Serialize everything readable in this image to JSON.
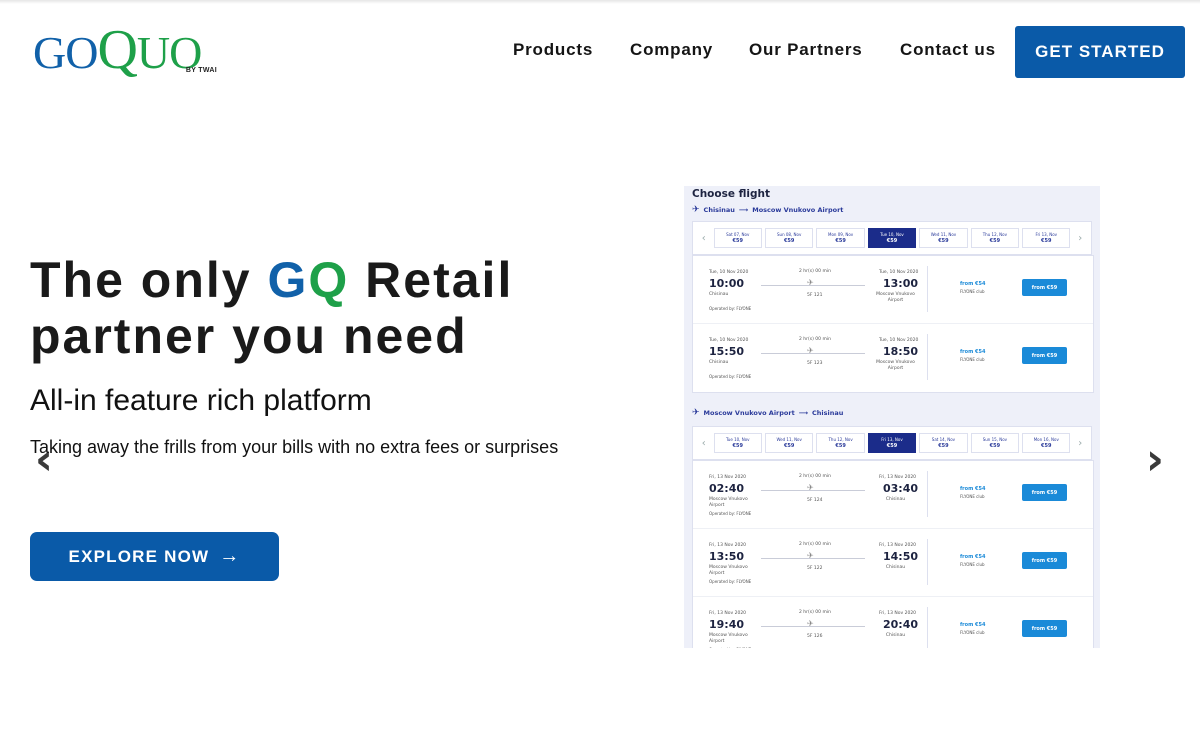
{
  "header": {
    "logo": {
      "go": "GO",
      "q": "Q",
      "uo": "UO",
      "tagline": "BY TWAI"
    },
    "nav": [
      {
        "label": "Products"
      },
      {
        "label": "Company"
      },
      {
        "label": "Our Partners"
      },
      {
        "label": "Contact us"
      }
    ],
    "cta_label": "GET STARTED"
  },
  "hero": {
    "headline_part1": "The only ",
    "headline_g": "G",
    "headline_q": "Q",
    "headline_part2": " Retail",
    "headline_line2": "partner you need",
    "subhead": "All-in feature rich platform",
    "description": "Taking away the frills from your bills with no extra fees or surprises",
    "explore_label": "EXPLORE NOW",
    "arrow_glyph": "→"
  },
  "carousel": {
    "prev_glyph": "‹",
    "next_glyph": "›"
  },
  "flight_panel": {
    "title": "Choose flight",
    "outbound": {
      "from": "Chisinau",
      "to": "Moscow Vnukovo Airport",
      "dates": [
        {
          "label": "Sat 07, Nov",
          "price": "€59"
        },
        {
          "label": "Sun 08, Nov",
          "price": "€59"
        },
        {
          "label": "Mon 09, Nov",
          "price": "€59"
        },
        {
          "label": "Tue 10, Nov",
          "price": "€59"
        },
        {
          "label": "Wed 11, Nov",
          "price": "€59"
        },
        {
          "label": "Thu 12, Nov",
          "price": "€59"
        },
        {
          "label": "Fri 13, Nov",
          "price": "€59"
        }
      ],
      "flights": [
        {
          "dep_date": "Tue, 10 Nov 2020",
          "dep": "10:00",
          "dep_place": "Chisinau",
          "duration": "2 hr(s) 00 min",
          "code": "5F 121",
          "arr_date": "Tue, 10 Nov 2020",
          "arr": "13:00",
          "arr_place": "Moscow Vnukovo Airport",
          "operator": "Operated by: FLYONE",
          "from_price": "from €54",
          "club": "FLYONE club",
          "button": "from €59"
        },
        {
          "dep_date": "Tue, 10 Nov 2020",
          "dep": "15:50",
          "dep_place": "Chisinau",
          "duration": "2 hr(s) 00 min",
          "code": "5F 123",
          "arr_date": "Tue, 10 Nov 2020",
          "arr": "18:50",
          "arr_place": "Moscow Vnukovo Airport",
          "operator": "Operated by: FLYONE",
          "from_price": "from €54",
          "club": "FLYONE club",
          "button": "from €59"
        }
      ]
    },
    "inbound": {
      "from": "Moscow Vnukovo Airport",
      "to": "Chisinau",
      "dates": [
        {
          "label": "Tue 10, Nov",
          "price": "€59"
        },
        {
          "label": "Wed 11, Nov",
          "price": "€59"
        },
        {
          "label": "Thu 12, Nov",
          "price": "€59"
        },
        {
          "label": "Fri 13, Nov",
          "price": "€59"
        },
        {
          "label": "Sat 14, Nov",
          "price": "€59"
        },
        {
          "label": "Sun 15, Nov",
          "price": "€59"
        },
        {
          "label": "Mon 16, Nov",
          "price": "€59"
        }
      ],
      "flights": [
        {
          "dep_date": "Fri, 13 Nov 2020",
          "dep": "02:40",
          "dep_place": "Moscow Vnukovo Airport",
          "duration": "2 hr(s) 00 min",
          "code": "5F 124",
          "arr_date": "Fri, 13 Nov 2020",
          "arr": "03:40",
          "arr_place": "Chisinau",
          "operator": "Operated by: FLYONE",
          "from_price": "from €54",
          "club": "FLYONE club",
          "button": "from €59"
        },
        {
          "dep_date": "Fri, 13 Nov 2020",
          "dep": "13:50",
          "dep_place": "Moscow Vnukovo Airport",
          "duration": "2 hr(s) 00 min",
          "code": "5F 122",
          "arr_date": "Fri, 13 Nov 2020",
          "arr": "14:50",
          "arr_place": "Chisinau",
          "operator": "Operated by: FLYONE",
          "from_price": "from €54",
          "club": "FLYONE club",
          "button": "from €59"
        },
        {
          "dep_date": "Fri, 13 Nov 2020",
          "dep": "19:40",
          "dep_place": "Moscow Vnukovo Airport",
          "duration": "2 hr(s) 00 min",
          "code": "5F 126",
          "arr_date": "Fri, 13 Nov 2020",
          "arr": "20:40",
          "arr_place": "Chisinau",
          "operator": "Operated by: FLYONE",
          "from_price": "from €54",
          "club": "FLYONE club",
          "button": "from €59"
        }
      ]
    }
  },
  "colors": {
    "brand_blue": "#0a5aa8",
    "brand_green": "#1ea049",
    "flight_accent": "#1a8ad8",
    "selected_date": "#1b2c8a"
  }
}
